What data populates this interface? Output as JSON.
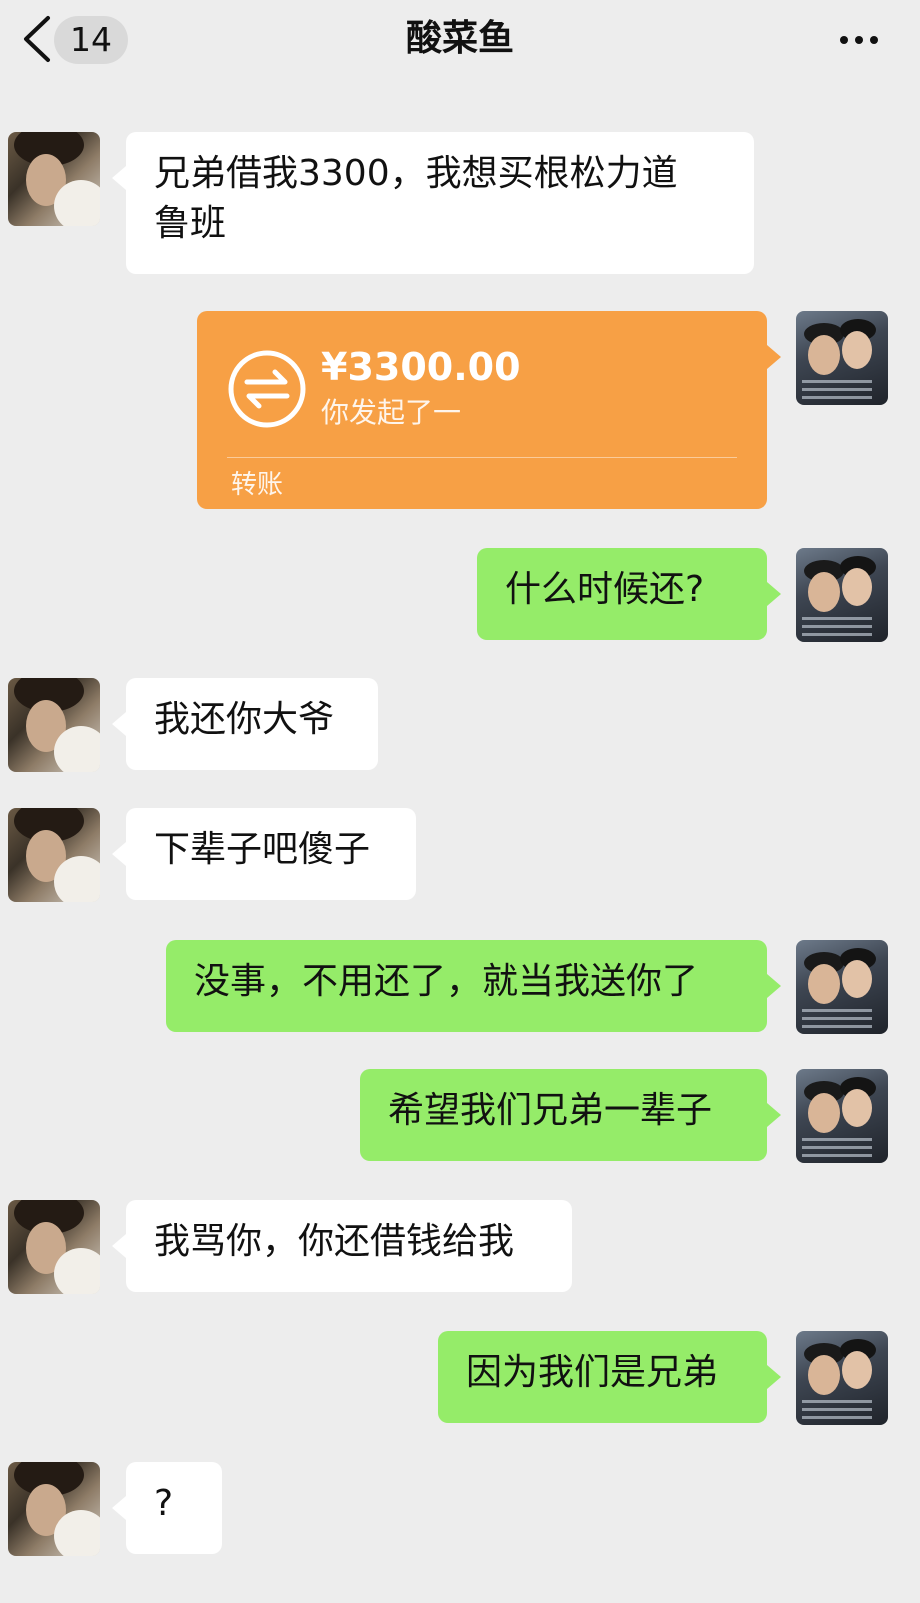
{
  "header": {
    "back_count": "14",
    "title": "酸菜鱼",
    "more_icon": "more-icon"
  },
  "messages": [
    {
      "side": "left",
      "text": "兄弟借我3300，我想买根松力道\n鲁班"
    },
    {
      "side": "right",
      "type": "transfer",
      "amount": "¥3300.00",
      "desc": "你发起了一",
      "label": "转账"
    },
    {
      "side": "right",
      "text": "什么时候还?"
    },
    {
      "side": "left",
      "text": "我还你大爷"
    },
    {
      "side": "left",
      "text": "下辈子吧傻子"
    },
    {
      "side": "right",
      "text": "没事，不用还了，就当我送你了"
    },
    {
      "side": "right",
      "text": "希望我们兄弟一辈子"
    },
    {
      "side": "left",
      "text": "我骂你，你还借钱给我"
    },
    {
      "side": "right",
      "text": "因为我们是兄弟"
    },
    {
      "side": "left",
      "text": "?"
    }
  ],
  "colors": {
    "background": "#ededed",
    "right_bubble": "#95ec69",
    "left_bubble": "#ffffff",
    "transfer_card": "#f7a045"
  }
}
